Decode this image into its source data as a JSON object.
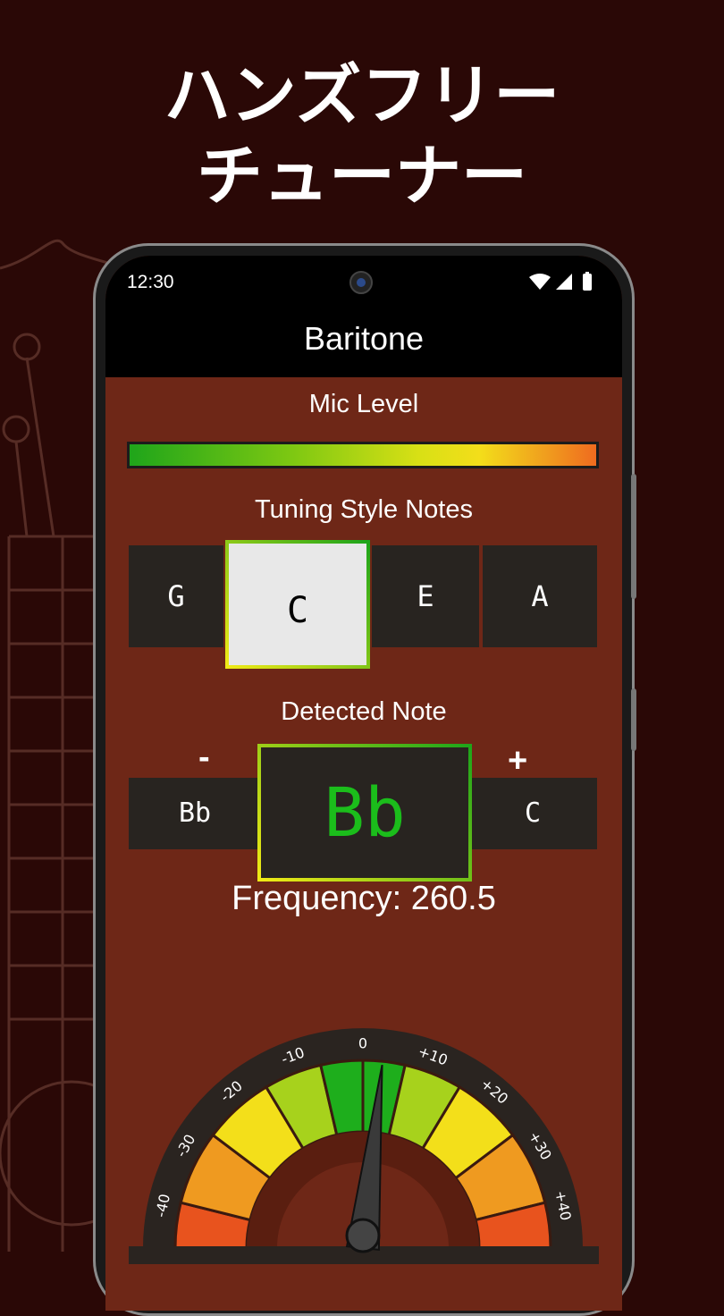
{
  "headline": {
    "line1": "ハンズフリー",
    "line2": "チューナー"
  },
  "status_bar": {
    "time": "12:30"
  },
  "app": {
    "title": "Baritone"
  },
  "mic": {
    "label": "Mic Level",
    "level": 1.0
  },
  "tuning": {
    "label": "Tuning Style Notes",
    "notes": [
      "G",
      "C",
      "E",
      "A"
    ],
    "selected": "C"
  },
  "detected": {
    "label": "Detected Note",
    "minus": "-",
    "plus": "+",
    "lower": "Bb",
    "note": "Bb",
    "higher": "C"
  },
  "frequency": {
    "text": "Frequency: 260.5"
  },
  "meter": {
    "ticks": [
      "-40",
      "-30",
      "-20",
      "-10",
      "0",
      "+10",
      "+20",
      "+30",
      "+40"
    ],
    "needle_cents": 3
  },
  "colors": {
    "background": "#2a0806",
    "screen": "#6e2717",
    "accent_green": "#1bbd1b"
  }
}
